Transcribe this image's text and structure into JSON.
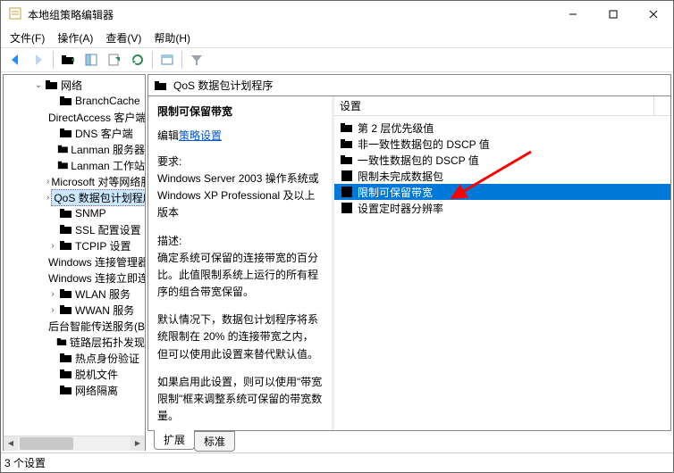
{
  "window": {
    "title": "本地组策略编辑器"
  },
  "menu": {
    "file": "文件(F)",
    "action": "操作(A)",
    "view": "查看(V)",
    "help": "帮助(H)"
  },
  "tree": {
    "items": [
      {
        "label": "网络",
        "indent": 2,
        "chevron": "down"
      },
      {
        "label": "BranchCache",
        "indent": 3,
        "chevron": ""
      },
      {
        "label": "DirectAccess 客户端体验设置",
        "indent": 3,
        "chevron": ""
      },
      {
        "label": "DNS 客户端",
        "indent": 3,
        "chevron": ""
      },
      {
        "label": "Lanman 服务器",
        "indent": 3,
        "chevron": ""
      },
      {
        "label": "Lanman 工作站",
        "indent": 3,
        "chevron": ""
      },
      {
        "label": "Microsoft 对等网络服务",
        "indent": 3,
        "chevron": "right"
      },
      {
        "label": "QoS 数据包计划程序",
        "indent": 3,
        "chevron": "right",
        "selected": true
      },
      {
        "label": "SNMP",
        "indent": 3,
        "chevron": ""
      },
      {
        "label": "SSL 配置设置",
        "indent": 3,
        "chevron": ""
      },
      {
        "label": "TCPIP 设置",
        "indent": 3,
        "chevron": "right"
      },
      {
        "label": "Windows 连接管理器",
        "indent": 3,
        "chevron": ""
      },
      {
        "label": "Windows 连接立即连接",
        "indent": 3,
        "chevron": ""
      },
      {
        "label": "WLAN 服务",
        "indent": 3,
        "chevron": "right"
      },
      {
        "label": "WWAN 服务",
        "indent": 3,
        "chevron": "right"
      },
      {
        "label": "后台智能传送服务(BITS)",
        "indent": 3,
        "chevron": ""
      },
      {
        "label": "链路层拓扑发现",
        "indent": 3,
        "chevron": ""
      },
      {
        "label": "热点身份验证",
        "indent": 3,
        "chevron": ""
      },
      {
        "label": "脱机文件",
        "indent": 3,
        "chevron": ""
      },
      {
        "label": "网络隔离",
        "indent": 3,
        "chevron": ""
      }
    ]
  },
  "path": {
    "label": "QoS 数据包计划程序"
  },
  "desc": {
    "title": "限制可保留带宽",
    "edit_prefix": "编辑",
    "edit_link": "策略设置",
    "req_label": "要求:",
    "req_body": "Windows Server 2003 操作系统或 Windows XP Professional 及以上版本",
    "descr_label": "描述:",
    "descr_body": "确定系统可保留的连接带宽的百分比。此值限制系统上运行的所有程序的组合带宽保留。",
    "para2": "默认情况下，数据包计划程序将系统限制在 20% 的连接带宽之内，但可以使用此设置来替代默认值。",
    "para3": "如果启用此设置，则可以使用\"带宽限制\"框来调整系统可保留的带宽数量。"
  },
  "list": {
    "header": "设置",
    "items": [
      {
        "icon": "folder",
        "label": "第 2 层优先级值"
      },
      {
        "icon": "folder",
        "label": "非一致性数据包的 DSCP 值"
      },
      {
        "icon": "folder",
        "label": "一致性数据包的 DSCP 值"
      },
      {
        "icon": "setting",
        "label": "限制未完成数据包"
      },
      {
        "icon": "setting",
        "label": "限制可保留带宽",
        "selected": true
      },
      {
        "icon": "setting",
        "label": "设置定时器分辨率"
      }
    ]
  },
  "tabs": {
    "extended": "扩展",
    "standard": "标准"
  },
  "status": {
    "text": "3 个设置"
  }
}
